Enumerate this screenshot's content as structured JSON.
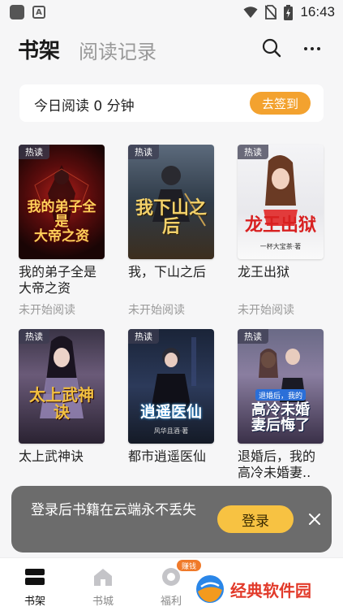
{
  "status_bar": {
    "time": "16:43",
    "notif_letter": "A"
  },
  "header": {
    "tab_active": "书架",
    "tab_inactive": "阅读记录"
  },
  "reading": {
    "text": "今日阅读 0 分钟",
    "checkin_label": "去签到"
  },
  "books": [
    {
      "badge": "热读",
      "title": "我的弟子全是大帝之资",
      "cover_title": "我的弟子全是\n大帝之资",
      "status": "未开始阅读"
    },
    {
      "badge": "热读",
      "title": "我，下山之后",
      "cover_title": "我下山之后",
      "status": "未开始阅读"
    },
    {
      "badge": "热读",
      "title": "龙王出狱",
      "cover_title": "龙王出狱",
      "cover_author": "一杯大宝茶·著",
      "status": "未开始阅读"
    },
    {
      "badge": "热读",
      "title": "太上武神诀",
      "cover_title": "太上武神诀",
      "status": ""
    },
    {
      "badge": "热读",
      "title": "都市逍遥医仙",
      "cover_title": "逍遥医仙",
      "cover_author": "风华且酒·著",
      "status": ""
    },
    {
      "badge": "热读",
      "title": "退婚后，我的高冷未婚妻..",
      "cover_title": "高冷未婚\n妻后悔了",
      "cover_subtitle": "退婚后，我的",
      "status": ""
    }
  ],
  "toast": {
    "text": "登录后书籍在云端永不丢失",
    "login_label": "登录"
  },
  "nav": {
    "items": [
      {
        "label": "书架"
      },
      {
        "label": "书城"
      },
      {
        "label": "福利"
      }
    ],
    "earn_badge": "赚钱"
  },
  "watermark": {
    "text": "经典软件园"
  }
}
